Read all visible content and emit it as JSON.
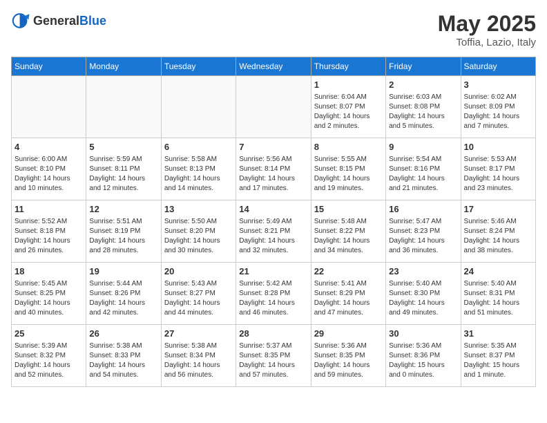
{
  "header": {
    "logo_general": "General",
    "logo_blue": "Blue",
    "month": "May 2025",
    "location": "Toffia, Lazio, Italy"
  },
  "days_of_week": [
    "Sunday",
    "Monday",
    "Tuesday",
    "Wednesday",
    "Thursday",
    "Friday",
    "Saturday"
  ],
  "weeks": [
    [
      {
        "day": "",
        "info": ""
      },
      {
        "day": "",
        "info": ""
      },
      {
        "day": "",
        "info": ""
      },
      {
        "day": "",
        "info": ""
      },
      {
        "day": "1",
        "info": "Sunrise: 6:04 AM\nSunset: 8:07 PM\nDaylight: 14 hours and 2 minutes."
      },
      {
        "day": "2",
        "info": "Sunrise: 6:03 AM\nSunset: 8:08 PM\nDaylight: 14 hours and 5 minutes."
      },
      {
        "day": "3",
        "info": "Sunrise: 6:02 AM\nSunset: 8:09 PM\nDaylight: 14 hours and 7 minutes."
      }
    ],
    [
      {
        "day": "4",
        "info": "Sunrise: 6:00 AM\nSunset: 8:10 PM\nDaylight: 14 hours and 10 minutes."
      },
      {
        "day": "5",
        "info": "Sunrise: 5:59 AM\nSunset: 8:11 PM\nDaylight: 14 hours and 12 minutes."
      },
      {
        "day": "6",
        "info": "Sunrise: 5:58 AM\nSunset: 8:13 PM\nDaylight: 14 hours and 14 minutes."
      },
      {
        "day": "7",
        "info": "Sunrise: 5:56 AM\nSunset: 8:14 PM\nDaylight: 14 hours and 17 minutes."
      },
      {
        "day": "8",
        "info": "Sunrise: 5:55 AM\nSunset: 8:15 PM\nDaylight: 14 hours and 19 minutes."
      },
      {
        "day": "9",
        "info": "Sunrise: 5:54 AM\nSunset: 8:16 PM\nDaylight: 14 hours and 21 minutes."
      },
      {
        "day": "10",
        "info": "Sunrise: 5:53 AM\nSunset: 8:17 PM\nDaylight: 14 hours and 23 minutes."
      }
    ],
    [
      {
        "day": "11",
        "info": "Sunrise: 5:52 AM\nSunset: 8:18 PM\nDaylight: 14 hours and 26 minutes."
      },
      {
        "day": "12",
        "info": "Sunrise: 5:51 AM\nSunset: 8:19 PM\nDaylight: 14 hours and 28 minutes."
      },
      {
        "day": "13",
        "info": "Sunrise: 5:50 AM\nSunset: 8:20 PM\nDaylight: 14 hours and 30 minutes."
      },
      {
        "day": "14",
        "info": "Sunrise: 5:49 AM\nSunset: 8:21 PM\nDaylight: 14 hours and 32 minutes."
      },
      {
        "day": "15",
        "info": "Sunrise: 5:48 AM\nSunset: 8:22 PM\nDaylight: 14 hours and 34 minutes."
      },
      {
        "day": "16",
        "info": "Sunrise: 5:47 AM\nSunset: 8:23 PM\nDaylight: 14 hours and 36 minutes."
      },
      {
        "day": "17",
        "info": "Sunrise: 5:46 AM\nSunset: 8:24 PM\nDaylight: 14 hours and 38 minutes."
      }
    ],
    [
      {
        "day": "18",
        "info": "Sunrise: 5:45 AM\nSunset: 8:25 PM\nDaylight: 14 hours and 40 minutes."
      },
      {
        "day": "19",
        "info": "Sunrise: 5:44 AM\nSunset: 8:26 PM\nDaylight: 14 hours and 42 minutes."
      },
      {
        "day": "20",
        "info": "Sunrise: 5:43 AM\nSunset: 8:27 PM\nDaylight: 14 hours and 44 minutes."
      },
      {
        "day": "21",
        "info": "Sunrise: 5:42 AM\nSunset: 8:28 PM\nDaylight: 14 hours and 46 minutes."
      },
      {
        "day": "22",
        "info": "Sunrise: 5:41 AM\nSunset: 8:29 PM\nDaylight: 14 hours and 47 minutes."
      },
      {
        "day": "23",
        "info": "Sunrise: 5:40 AM\nSunset: 8:30 PM\nDaylight: 14 hours and 49 minutes."
      },
      {
        "day": "24",
        "info": "Sunrise: 5:40 AM\nSunset: 8:31 PM\nDaylight: 14 hours and 51 minutes."
      }
    ],
    [
      {
        "day": "25",
        "info": "Sunrise: 5:39 AM\nSunset: 8:32 PM\nDaylight: 14 hours and 52 minutes."
      },
      {
        "day": "26",
        "info": "Sunrise: 5:38 AM\nSunset: 8:33 PM\nDaylight: 14 hours and 54 minutes."
      },
      {
        "day": "27",
        "info": "Sunrise: 5:38 AM\nSunset: 8:34 PM\nDaylight: 14 hours and 56 minutes."
      },
      {
        "day": "28",
        "info": "Sunrise: 5:37 AM\nSunset: 8:35 PM\nDaylight: 14 hours and 57 minutes."
      },
      {
        "day": "29",
        "info": "Sunrise: 5:36 AM\nSunset: 8:35 PM\nDaylight: 14 hours and 59 minutes."
      },
      {
        "day": "30",
        "info": "Sunrise: 5:36 AM\nSunset: 8:36 PM\nDaylight: 15 hours and 0 minutes."
      },
      {
        "day": "31",
        "info": "Sunrise: 5:35 AM\nSunset: 8:37 PM\nDaylight: 15 hours and 1 minute."
      }
    ]
  ]
}
